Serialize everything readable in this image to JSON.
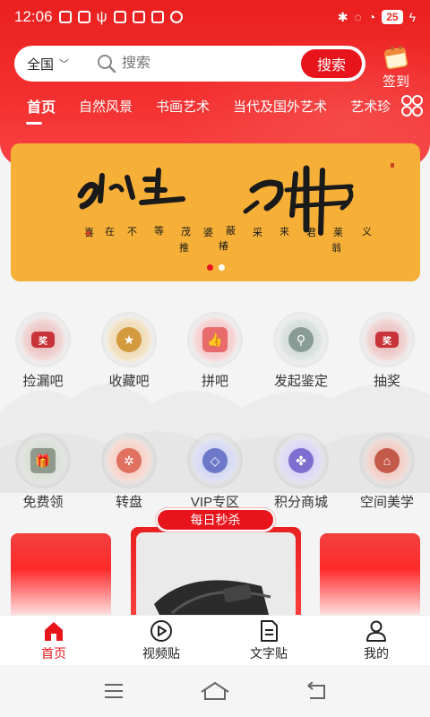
{
  "status": {
    "time": "12:06",
    "battery": "25"
  },
  "search": {
    "region": "全国",
    "placeholder": "搜索",
    "button_label": "搜索"
  },
  "signin_label": "签到",
  "tabs": [
    {
      "label": "首页",
      "active": true
    },
    {
      "label": "自然风景"
    },
    {
      "label": "书画艺术"
    },
    {
      "label": "当代及国外艺术"
    },
    {
      "label": "艺术珍"
    }
  ],
  "banner": {
    "slides": 2,
    "active_slide": 1
  },
  "grid": [
    {
      "label": "捡漏吧",
      "icon": "ticket-icon",
      "color": "#c8343a"
    },
    {
      "label": "收藏吧",
      "icon": "star-icon",
      "color": "#d49a3e"
    },
    {
      "label": "拼吧",
      "icon": "thumbs-up-icon",
      "color": "#e86b6b"
    },
    {
      "label": "发起鉴定",
      "icon": "stamp-icon",
      "color": "#8a9c96"
    },
    {
      "label": "抽奖",
      "icon": "ticket-icon",
      "color": "#c8343a"
    },
    {
      "label": "免费领",
      "icon": "gift-icon",
      "color": "#8f9a8c"
    },
    {
      "label": "转盘",
      "icon": "wheel-icon",
      "color": "#e07060"
    },
    {
      "label": "VIP专区",
      "icon": "diamond-icon",
      "color": "#6d78c8"
    },
    {
      "label": "积分商城",
      "icon": "clover-icon",
      "color": "#7d6ed0"
    },
    {
      "label": "空间美学",
      "icon": "house-icon",
      "color": "#c45a4a"
    }
  ],
  "flash_sale": {
    "title": "每日秒杀"
  },
  "bottom_nav": [
    {
      "label": "首页",
      "icon": "home-icon",
      "active": true
    },
    {
      "label": "视频贴",
      "icon": "play-icon"
    },
    {
      "label": "文字贴",
      "icon": "document-icon"
    },
    {
      "label": "我的",
      "icon": "user-icon"
    }
  ],
  "colors": {
    "brand_red": "#e8141c",
    "banner": "#f6b038"
  }
}
